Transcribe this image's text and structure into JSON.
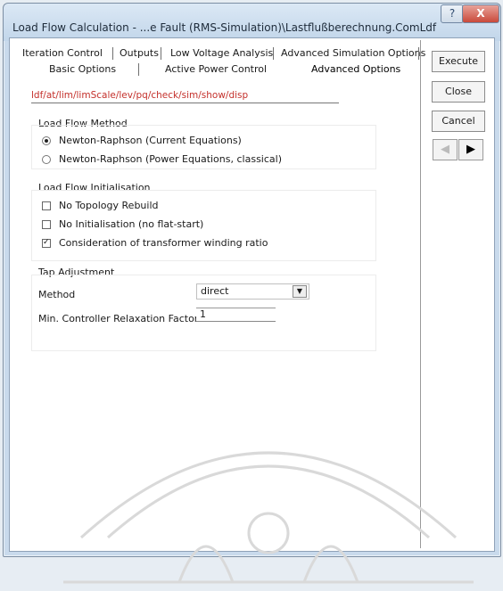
{
  "window": {
    "title": "Load Flow Calculation - ...e Fault (RMS-Simulation)\\Lastflußberechnung.ComLdf",
    "help_label": "?",
    "close_label": "X"
  },
  "tabs": {
    "row1": [
      "Iteration Control",
      "Outputs",
      "Low Voltage Analysis",
      "Advanced Simulation Options"
    ],
    "row2": [
      "Basic Options",
      "Active Power Control",
      "Advanced Options"
    ],
    "selected": "Advanced Options"
  },
  "path_value": "ldf/at/lim/limScale/lev/pq/check/sim/show/disp",
  "load_flow_method": {
    "title": "Load Flow Method",
    "options": [
      {
        "label": "Newton-Raphson (Current Equations)",
        "selected": true
      },
      {
        "label": "Newton-Raphson (Power Equations, classical)",
        "selected": false
      }
    ]
  },
  "load_flow_init": {
    "title": "Load Flow Initialisation",
    "options": [
      {
        "label": "No Topology Rebuild",
        "checked": false
      },
      {
        "label": "No Initialisation (no flat-start)",
        "checked": false
      },
      {
        "label": "Consideration of transformer winding ratio",
        "checked": true
      }
    ]
  },
  "tap_adjustment": {
    "title": "Tap Adjustment",
    "method_label": "Method",
    "method_value": "direct",
    "relax_label": "Min. Controller Relaxation Factor",
    "relax_value": "1"
  },
  "buttons": {
    "execute": "Execute",
    "close": "Close",
    "cancel": "Cancel",
    "prev_icon": "◀",
    "next_icon": "▶"
  },
  "colors": {
    "path_text": "#c4302b",
    "title_bg": "#c9daec"
  }
}
